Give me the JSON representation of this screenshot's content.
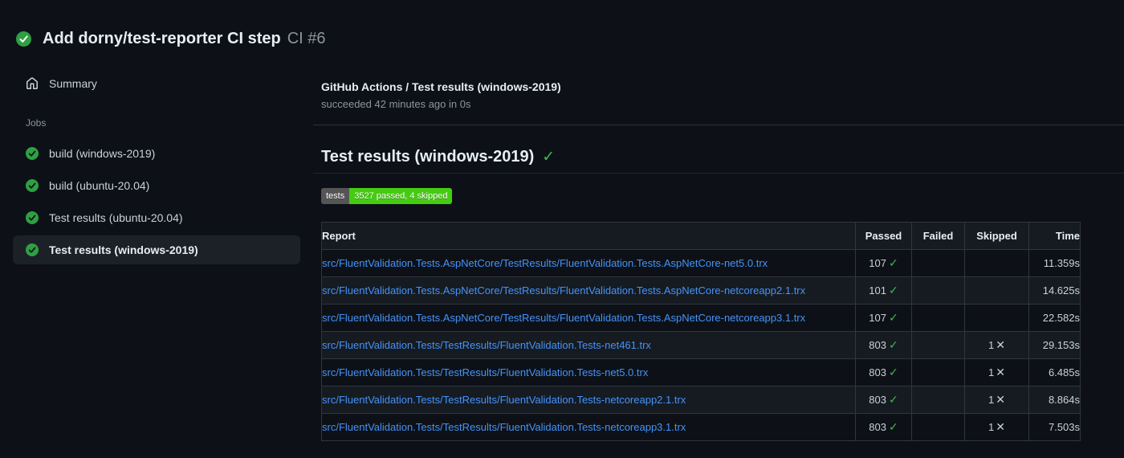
{
  "run_header": {
    "title": "Add dorny/test-reporter CI step",
    "run_number": "CI #6",
    "status": "success"
  },
  "sidebar": {
    "summary_label": "Summary",
    "jobs_label": "Jobs",
    "jobs": [
      {
        "label": "build (windows-2019)",
        "selected": false
      },
      {
        "label": "build (ubuntu-20.04)",
        "selected": false
      },
      {
        "label": "Test results (ubuntu-20.04)",
        "selected": false
      },
      {
        "label": "Test results (windows-2019)",
        "selected": true
      }
    ]
  },
  "check_header": {
    "title": "GitHub Actions / Test results (windows-2019)",
    "status_line": "succeeded 42 minutes ago in 0s"
  },
  "summary": {
    "heading": "Test results (windows-2019)",
    "heading_check_glyph": "✓",
    "badge": {
      "label": "tests",
      "value": "3527 passed, 4 skipped",
      "label_bg": "#555555",
      "value_bg": "#44cc11"
    }
  },
  "table": {
    "columns": [
      "Report",
      "Passed",
      "Failed",
      "Skipped",
      "Time"
    ],
    "rows": [
      {
        "report": "src/FluentValidation.Tests.AspNetCore/TestResults/FluentValidation.Tests.AspNetCore-net5.0.trx",
        "passed": "107",
        "failed": "",
        "skipped": "",
        "time": "11.359s"
      },
      {
        "report": "src/FluentValidation.Tests.AspNetCore/TestResults/FluentValidation.Tests.AspNetCore-netcoreapp2.1.trx",
        "passed": "101",
        "failed": "",
        "skipped": "",
        "time": "14.625s"
      },
      {
        "report": "src/FluentValidation.Tests.AspNetCore/TestResults/FluentValidation.Tests.AspNetCore-netcoreapp3.1.trx",
        "passed": "107",
        "failed": "",
        "skipped": "",
        "time": "22.582s"
      },
      {
        "report": "src/FluentValidation.Tests/TestResults/FluentValidation.Tests-net461.trx",
        "passed": "803",
        "failed": "",
        "skipped": "1",
        "time": "29.153s"
      },
      {
        "report": "src/FluentValidation.Tests/TestResults/FluentValidation.Tests-net5.0.trx",
        "passed": "803",
        "failed": "",
        "skipped": "1",
        "time": "6.485s"
      },
      {
        "report": "src/FluentValidation.Tests/TestResults/FluentValidation.Tests-netcoreapp2.1.trx",
        "passed": "803",
        "failed": "",
        "skipped": "1",
        "time": "8.864s"
      },
      {
        "report": "src/FluentValidation.Tests/TestResults/FluentValidation.Tests-netcoreapp3.1.trx",
        "passed": "803",
        "failed": "",
        "skipped": "1",
        "time": "7.503s"
      }
    ],
    "pass_glyph": "✓",
    "skip_glyph": "✕"
  },
  "colors": {
    "background": "#0d1117",
    "success_green": "#2ea043",
    "check_green": "#3fb950",
    "link_blue": "#4493f8",
    "badge_green": "#44cc11",
    "badge_gray": "#555555"
  }
}
